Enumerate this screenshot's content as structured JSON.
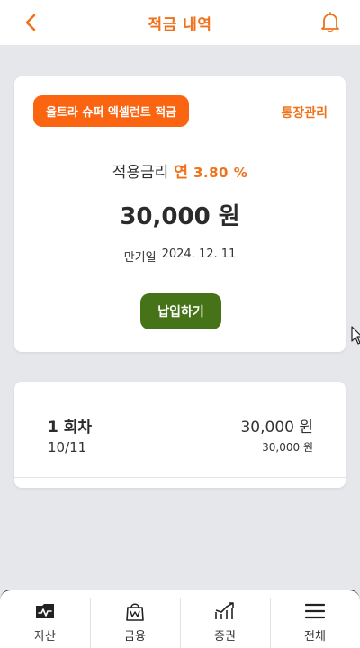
{
  "header": {
    "title": "적금 내역",
    "back_icon": "chevron-left-icon",
    "bell_icon": "bell-icon",
    "accent_color": "#f0711a"
  },
  "product": {
    "badge": "울트라 슈퍼 엑셀런트 적금",
    "manage_link": "통장관리",
    "rate_label": "적용금리",
    "rate_prefix": "연",
    "rate_value": "3.80 %",
    "amount": "30,000 원",
    "maturity_label": "만기일",
    "maturity_date": "2024. 12. 11",
    "pay_button": "납입하기",
    "badge_color": "#fb6410",
    "pay_button_color": "#467317"
  },
  "history": {
    "rows": [
      {
        "title": "1 회차",
        "date": "10/11",
        "amount": "30,000 원",
        "sub_amount": "30,000 원"
      }
    ]
  },
  "bottom_nav": {
    "items": [
      {
        "label": "자산",
        "icon": "wallet-icon"
      },
      {
        "label": "금융",
        "icon": "shopping-bag-icon"
      },
      {
        "label": "증권",
        "icon": "trend-chart-icon"
      },
      {
        "label": "전체",
        "icon": "menu-icon"
      }
    ]
  }
}
